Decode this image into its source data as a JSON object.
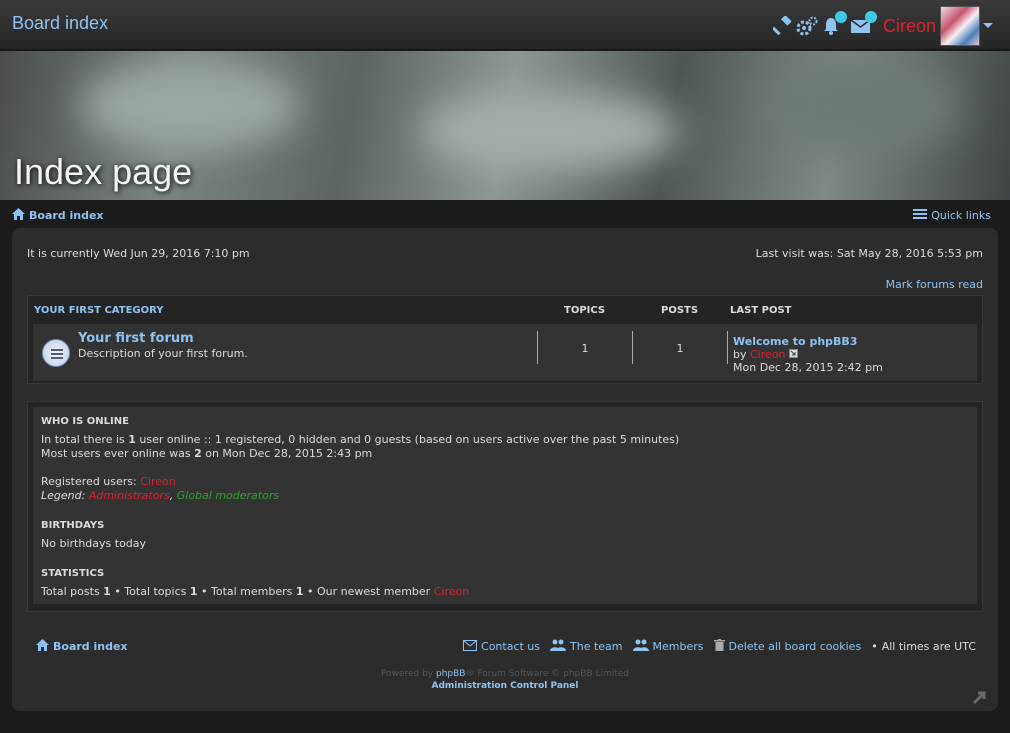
{
  "topbar": {
    "brand": "Board index",
    "username": "Cireon",
    "icons": [
      "gavel-icon",
      "cogs-icon",
      "bell-icon",
      "envelope-icon",
      "chevron-down-icon"
    ]
  },
  "banner": {
    "title": "Index page"
  },
  "nav": {
    "board_index": "Board index",
    "quick_links": "Quick links"
  },
  "info": {
    "current_time": "It is currently Wed Jun 29, 2016 7:10 pm",
    "last_visit": "Last visit was: Sat May 28, 2016 5:53 pm",
    "mark_read": "Mark forums read"
  },
  "category": {
    "name": "Your first category",
    "col_topics": "Topics",
    "col_posts": "Posts",
    "col_lastpost": "Last post",
    "forum": {
      "title": "Your first forum",
      "desc": "Description of your first forum.",
      "topics": "1",
      "posts": "1",
      "last_post_title": "Welcome to phpBB3",
      "by": "by",
      "last_post_user": "Cireon",
      "last_post_time": "Mon Dec 28, 2015 2:42 pm"
    }
  },
  "who": {
    "heading": "Who is online",
    "line1_a": "In total there is ",
    "line1_b": "1",
    "line1_c": " user online :: 1 registered, 0 hidden and 0 guests (based on users active over the past 5 minutes)",
    "line2_a": "Most users ever online was ",
    "line2_b": "2",
    "line2_c": " on Mon Dec 28, 2015 2:43 pm",
    "registered_label": "Registered users: ",
    "registered_user": "Cireon",
    "legend_label": "Legend: ",
    "legend_admin": "Administrators",
    "legend_sep": ", ",
    "legend_mods": "Global moderators",
    "birthdays_heading": "Birthdays",
    "birthdays_text": "No birthdays today",
    "stats_heading": "Statistics",
    "stats_a": "Total posts ",
    "stats_b": "1",
    "stats_c": " • Total topics ",
    "stats_d": "1",
    "stats_e": " • Total members ",
    "stats_f": "1",
    "stats_g": " • Our newest member ",
    "stats_user": "Cireon"
  },
  "footer": {
    "board_index": "Board index",
    "contact": "Contact us",
    "team": "The team",
    "members": "Members",
    "delete_cookies": "Delete all board cookies",
    "bullet": "•",
    "timezone": "All times are UTC",
    "powered_a": "Powered by ",
    "powered_link": "phpBB",
    "powered_b": "® Forum Software © phpBB Limited",
    "acp": "Administration Control Panel"
  },
  "colors": {
    "link": "#8ec3f2",
    "admin_red": "#d8242c",
    "mod_green": "#29a629",
    "badge": "#3fc9e6"
  }
}
